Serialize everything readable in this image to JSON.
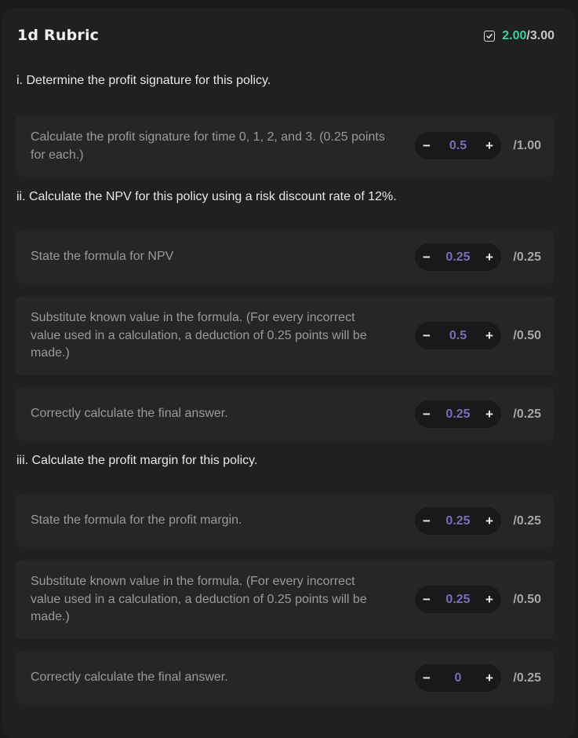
{
  "rubric": {
    "title": "1d Rubric",
    "score_earned": "2.00",
    "score_total": "/3.00",
    "score_icon": "checkbox-check-icon"
  },
  "sections": [
    {
      "title": "i. Determine the profit signature for this policy.",
      "criteria": [
        {
          "description": "Calculate the profit signature for time 0, 1, 2, and 3. (0.25 points for each.)",
          "value": "0.5",
          "max": "/1.00"
        }
      ]
    },
    {
      "title": "ii. Calculate the NPV for this policy using a risk discount rate of 12%.",
      "criteria": [
        {
          "description": "State the formula for NPV",
          "value": "0.25",
          "max": "/0.25"
        },
        {
          "description": "Substitute known value in the formula. (For every incorrect value used in a calculation, a deduction of 0.25 points will be made.)",
          "value": "0.5",
          "max": "/0.50"
        },
        {
          "description": "Correctly calculate the final answer.",
          "value": "0.25",
          "max": "/0.25"
        }
      ]
    },
    {
      "title": "iii. Calculate the profit margin for this policy.",
      "criteria": [
        {
          "description": "State the formula for the profit margin.",
          "value": "0.25",
          "max": "/0.25"
        },
        {
          "description": "Substitute known value in the formula. (For every incorrect value used in a calculation, a deduction of 0.25 points will be made.)",
          "value": "0.25",
          "max": "/0.50"
        },
        {
          "description": "Correctly calculate the final answer.",
          "value": "0",
          "max": "/0.25"
        }
      ]
    }
  ],
  "stepper": {
    "minus_label": "−",
    "plus_label": "+"
  },
  "colors": {
    "accent_green": "#3fcf9a",
    "value_purple": "#7d6bb8",
    "background": "#1a1b1d",
    "card": "#252628"
  }
}
